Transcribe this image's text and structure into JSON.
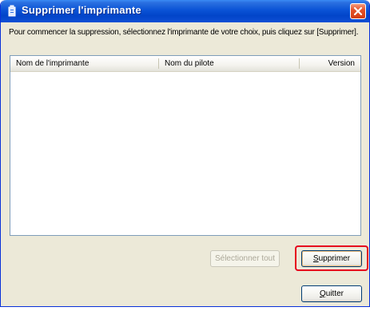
{
  "window": {
    "title": "Supprimer l'imprimante"
  },
  "instruction": "Pour commencer la suppression, sélectionnez l'imprimante de votre choix, puis cliquez sur [Supprimer].",
  "printer_list": {
    "columns": [
      "Nom de l'imprimante",
      "Nom du pilote",
      "Version"
    ],
    "rows": []
  },
  "buttons": {
    "select_all": "Sélectionner tout",
    "delete": "Supprimer",
    "quit": "Quitter"
  },
  "colors": {
    "title_bar": "#0a53d6",
    "window_bg": "#ece9d8",
    "highlight": "#e6001e",
    "close_button": "#d23d14"
  },
  "icons": {
    "title": "printer-delete-icon",
    "close": "close-icon"
  }
}
